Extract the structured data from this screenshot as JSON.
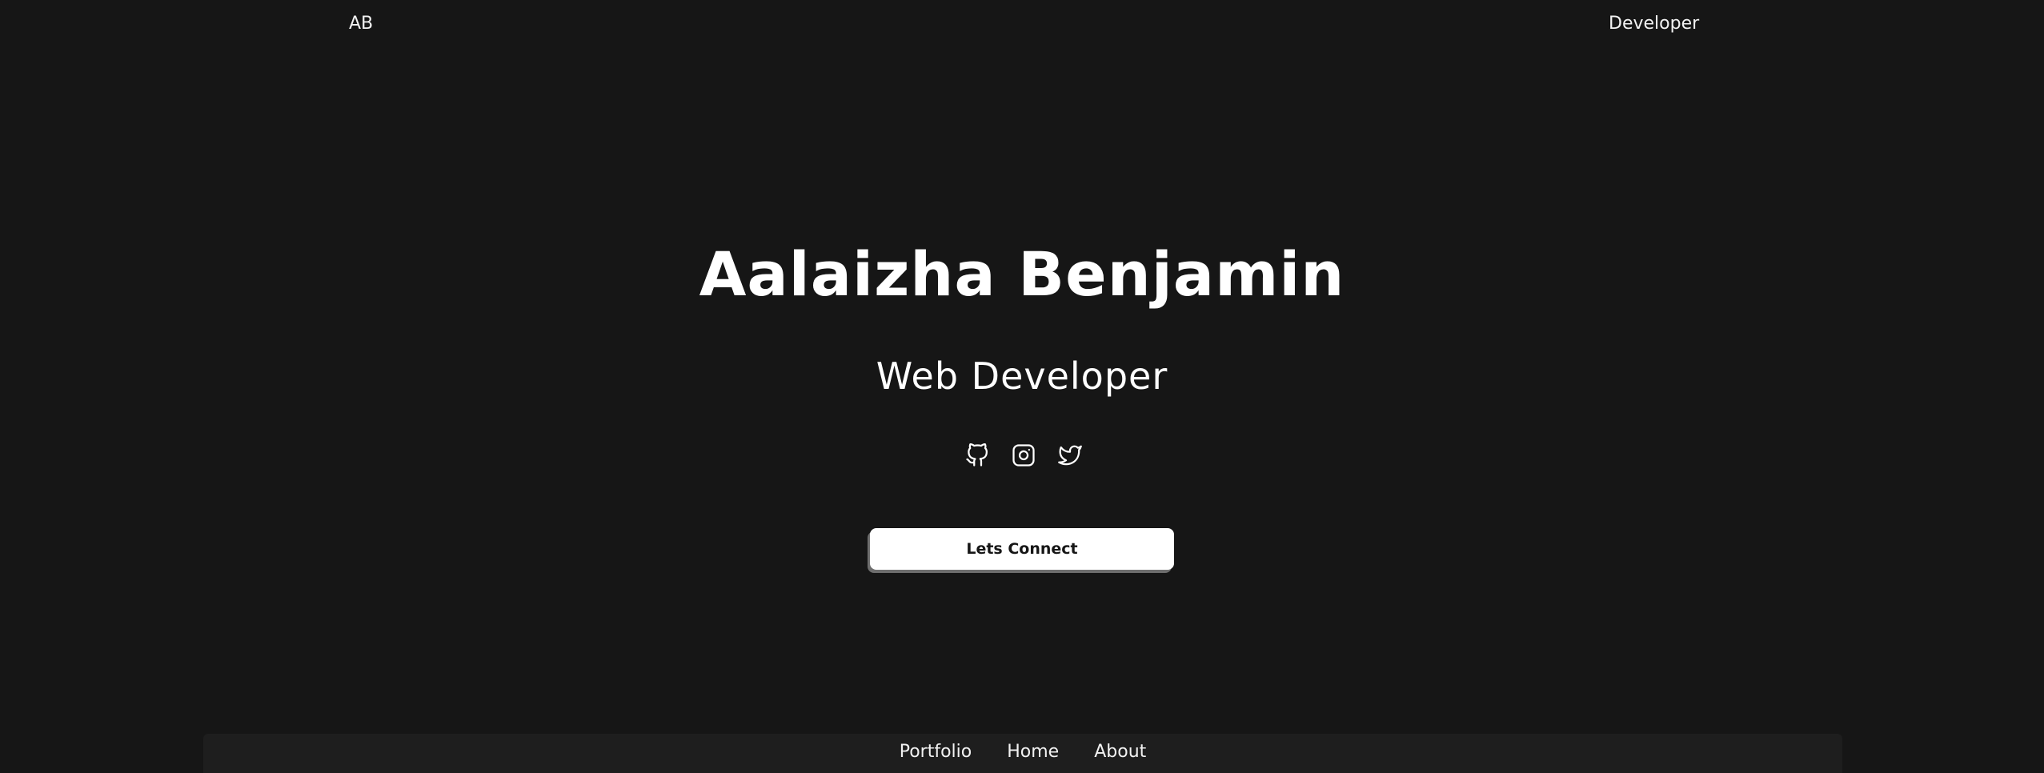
{
  "header": {
    "logo": "AB",
    "role": "Developer"
  },
  "hero": {
    "name": "Aalaizha Benjamin",
    "title": "Web Developer",
    "cta_label": "Lets Connect"
  },
  "socials": [
    {
      "name": "github",
      "icon": "github-icon"
    },
    {
      "name": "instagram",
      "icon": "instagram-icon"
    },
    {
      "name": "twitter",
      "icon": "twitter-icon"
    }
  ],
  "bottom_nav": {
    "items": [
      {
        "label": "Portfolio"
      },
      {
        "label": "Home"
      },
      {
        "label": "About"
      }
    ]
  },
  "colors": {
    "background": "#161616",
    "nav_background": "#1e1e1e",
    "text": "#ffffff",
    "button": "#ffffff",
    "button_text": "#161616"
  }
}
